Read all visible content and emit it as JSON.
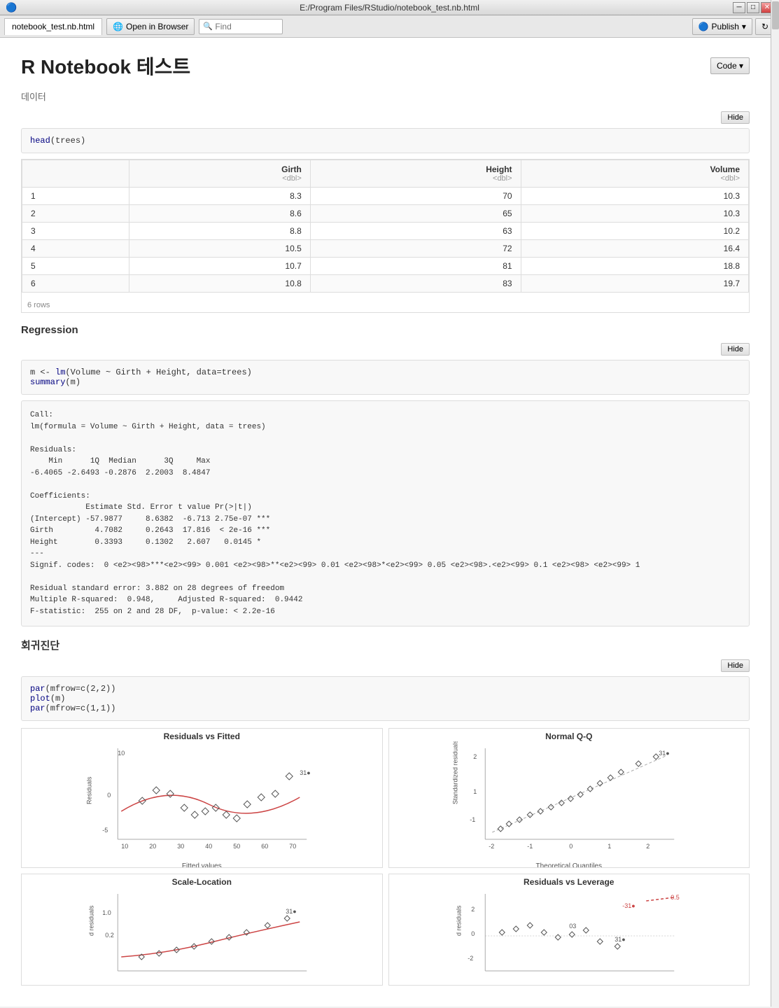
{
  "titlebar": {
    "title": "E:/Program Files/RStudio/notebook_test.nb.html",
    "icon": "🔵"
  },
  "toolbar": {
    "tab_label": "notebook_test.nb.html",
    "open_browser_label": "Open in Browser",
    "find_placeholder": "Find",
    "publish_label": "Publish",
    "refresh_icon": "↻"
  },
  "page": {
    "title": "R Notebook 테스트",
    "section1_label": "데이터",
    "section2_label": "Regression",
    "section3_label": "회귀진단",
    "code_button": "Code ▾",
    "hide_label": "Hide"
  },
  "chunk1": {
    "code": "head(trees)"
  },
  "table": {
    "headers": [
      "",
      "Girth",
      "Height",
      "Volume"
    ],
    "types": [
      "",
      "<dbl>",
      "<dbl>",
      "<dbl>"
    ],
    "rows": [
      [
        "1",
        "8.3",
        "70",
        "10.3"
      ],
      [
        "2",
        "8.6",
        "65",
        "10.3"
      ],
      [
        "3",
        "8.8",
        "63",
        "10.2"
      ],
      [
        "4",
        "10.5",
        "72",
        "16.4"
      ],
      [
        "5",
        "10.7",
        "81",
        "18.8"
      ],
      [
        "6",
        "10.8",
        "83",
        "19.7"
      ]
    ],
    "row_count": "6 rows"
  },
  "chunk2": {
    "code_line1": "m <- lm(Volume ~ Girth + Height, data=trees)",
    "code_line2": "summary(m)"
  },
  "output": {
    "text": "Call:\nlm(formula = Volume ~ Girth + Height, data = trees)\n\nResiduals:\n    Min      1Q  Median      3Q     Max\n-6.4065 -2.6493 -0.2876  2.2003  8.4847\n\nCoefficients:\n            Estimate Std. Error t value Pr(>|t|)\n(Intercept) -57.9877     8.6382  -6.713 2.75e-07 ***\nGirth         4.7082     0.2643  17.816  < 2e-16 ***\nHeight        0.3393     0.1302   2.607   0.0145 *\n---\nSignif. codes:  0 <e2><98>***<e2><99> 0.001 <e2><98>**<e2><99> 0.01 <e2><98>*<e2><99> 0.05 <e2><98>.<e2><99> 0.1 <e2><98> <e2><99> 1\n\nResidual standard error: 3.882 on 28 degrees of freedom\nMultiple R-squared:  0.948,\tAdjusted R-squared:  0.9442\nF-statistic:  255 on 2 and 28 DF,  p-value: < 2.2e-16"
  },
  "chunk3": {
    "code_line1": "par(mfrow=c(2,2))",
    "code_line2": "plot(m)",
    "code_line3": "par(mfrow=c(1,1))"
  },
  "plots": {
    "plot1_title": "Residuals vs Fitted",
    "plot1_x": "Fitted values",
    "plot1_y": "Residuals",
    "plot2_title": "Normal Q-Q",
    "plot2_x": "Theoretical Quantiles",
    "plot2_y": "Standardized residuals",
    "plot3_title": "Scale-Location",
    "plot3_x": "",
    "plot3_y": "d residuals",
    "plot4_title": "Residuals vs Leverage",
    "plot4_x": "",
    "plot4_y": "d residuals"
  }
}
